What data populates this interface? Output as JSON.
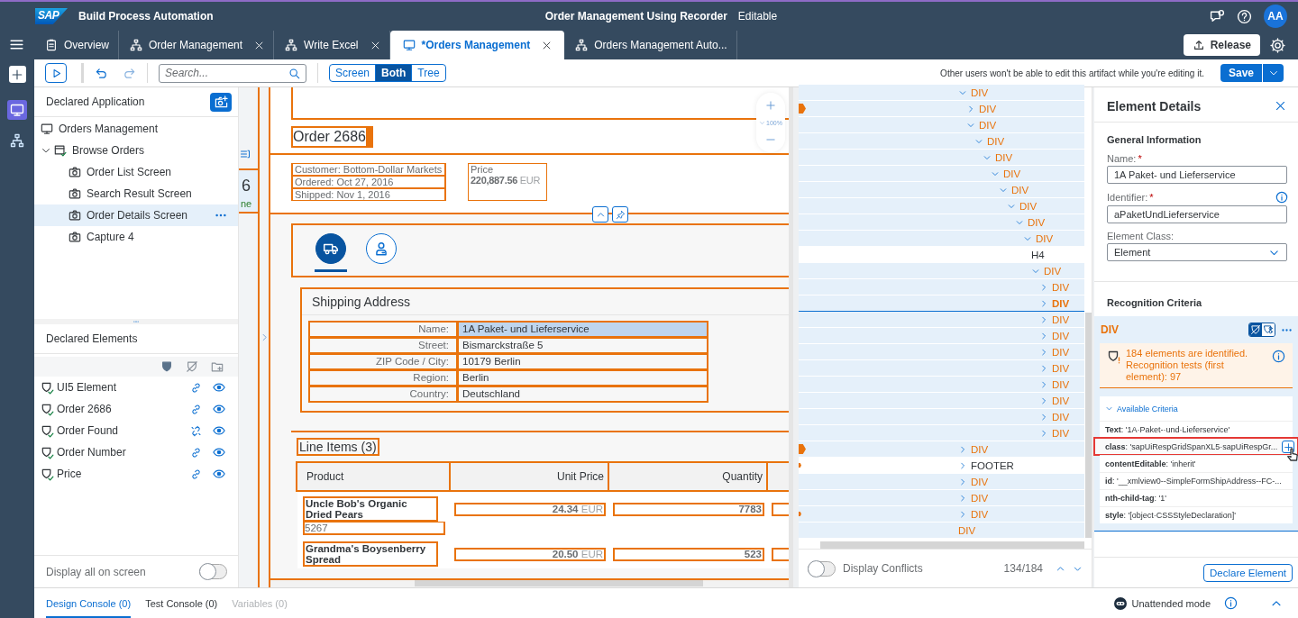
{
  "shell": {
    "logo": "SAP",
    "product": "Build Process Automation",
    "title": "Order Management Using Recorder",
    "status": "Editable",
    "avatar": "AA"
  },
  "tabs": [
    {
      "kind": "overview",
      "label": "Overview",
      "selected": false,
      "closable": false
    },
    {
      "kind": "process",
      "label": "Order Management",
      "selected": false,
      "closable": true
    },
    {
      "kind": "process",
      "label": "Write Excel",
      "selected": false,
      "closable": true
    },
    {
      "kind": "application",
      "label": "*Orders Management",
      "selected": true,
      "closable": true
    },
    {
      "kind": "process",
      "label": "Orders Management Auto...",
      "selected": false,
      "closable": false
    }
  ],
  "release_button": "Release",
  "rail": [
    {
      "kind": "screen",
      "selected": true
    },
    {
      "kind": "tree",
      "selected": false
    }
  ],
  "toolbar": {
    "search": {
      "placeholder": "Search..."
    },
    "view_modes": [
      {
        "label": "Screen",
        "selected": false
      },
      {
        "label": "Both",
        "selected": true
      },
      {
        "label": "Tree",
        "selected": false
      }
    ],
    "message": "Other users won't be able to edit this artifact while you're editing it.",
    "save_button": "Save"
  },
  "declared_application": {
    "title": "Declared Application",
    "tree": [
      {
        "kind": "application",
        "label": "Orders Management",
        "selected": false
      },
      {
        "kind": "page",
        "label": "Browse Orders",
        "selected": false,
        "expanded": true,
        "children": [
          {
            "kind": "screen",
            "label": "Order List Screen",
            "selected": false
          },
          {
            "kind": "screen",
            "label": "Search Result Screen",
            "selected": false
          },
          {
            "kind": "screen",
            "label": "Order Details Screen",
            "selected": true
          },
          {
            "kind": "screen",
            "label": "Capture 4",
            "selected": false
          }
        ]
      }
    ]
  },
  "declared_elements": {
    "title": "Declared Elements",
    "items": [
      {
        "label": "UI5 Element",
        "linked": true
      },
      {
        "label": "Order 2686",
        "linked": true
      },
      {
        "label": "Order Found",
        "linked": false
      },
      {
        "label": "Order Number",
        "linked": true
      },
      {
        "label": "Price",
        "linked": true
      }
    ]
  },
  "display_all": {
    "label": "Display all on screen",
    "on": false
  },
  "canvas": {
    "left_edge": {
      "count": "6",
      "status": "ne"
    },
    "zoom": "100%",
    "order": {
      "title": "Order 2686",
      "customer": "Customer: Bottom-Dollar Markets",
      "ordered": "Ordered: Oct 27, 2016",
      "shipped": "Shipped: Nov 1, 2016",
      "price_label": "Price",
      "price_value": "220,887.56",
      "price_currency": "EUR"
    },
    "icon_tabs": [
      {
        "kind": "truck",
        "selected": true
      },
      {
        "kind": "person",
        "selected": false
      }
    ],
    "shipping": {
      "title": "Shipping Address",
      "fields": [
        {
          "label": "Name:",
          "value": "1A Paket- und Lieferservice",
          "highlighted": true
        },
        {
          "label": "Street:",
          "value": "Bismarckstraße 5",
          "highlighted": false
        },
        {
          "label": "ZIP Code / City:",
          "value": "10179 Berlin",
          "highlighted": false
        },
        {
          "label": "Region:",
          "value": "Berlin",
          "highlighted": false
        },
        {
          "label": "Country:",
          "value": "Deutschland",
          "highlighted": false
        }
      ]
    },
    "line_items": {
      "title": "Line Items (3)",
      "columns": [
        "Product",
        "Unit Price",
        "Quantity"
      ],
      "rows": [
        {
          "product": "Uncle Bob's Organic Dried Pears",
          "product_number": "5267",
          "price": "24.34",
          "currency": "EUR",
          "quantity": "7783"
        },
        {
          "product": "Grandma's Boysenberry Spread",
          "price": "20.50",
          "currency": "EUR",
          "quantity": "523"
        }
      ]
    }
  },
  "dom_tree": {
    "rows": [
      {
        "tag": "DIV",
        "kind": "node",
        "expanded": true,
        "highlighted": true,
        "selected": false,
        "children": [
          {
            "tag": "DIV",
            "kind": "node",
            "expanded": false,
            "highlighted": true,
            "selected": false,
            "flagged": true
          },
          {
            "tag": "DIV",
            "kind": "node",
            "expanded": true,
            "highlighted": true,
            "selected": false,
            "children": [
              {
                "tag": "DIV",
                "kind": "node",
                "expanded": true,
                "highlighted": true,
                "selected": false,
                "children": [
                  {
                    "tag": "DIV",
                    "kind": "node",
                    "expanded": true,
                    "highlighted": true,
                    "selected": false,
                    "children": [
                      {
                        "tag": "DIV",
                        "kind": "node",
                        "expanded": true,
                        "highlighted": true,
                        "selected": false,
                        "children": [
                          {
                            "tag": "DIV",
                            "kind": "node",
                            "expanded": true,
                            "highlighted": true,
                            "selected": false,
                            "children": [
                              {
                                "tag": "DIV",
                                "kind": "node",
                                "expanded": true,
                                "highlighted": true,
                                "selected": false,
                                "children": [
                                  {
                                    "tag": "DIV",
                                    "kind": "node",
                                    "expanded": true,
                                    "highlighted": true,
                                    "selected": false,
                                    "children": [
                                      {
                                        "tag": "DIV",
                                        "kind": "node",
                                        "expanded": true,
                                        "highlighted": true,
                                        "selected": false,
                                        "children": [
                                          {
                                            "tag": "H4",
                                            "kind": "leaf",
                                            "highlighted": false,
                                            "selected": false
                                          },
                                          {
                                            "tag": "DIV",
                                            "kind": "node",
                                            "expanded": true,
                                            "highlighted": true,
                                            "selected": false,
                                            "children": [
                                              {
                                                "tag": "DIV",
                                                "kind": "node",
                                                "expanded": false,
                                                "highlighted": true,
                                                "selected": false
                                              },
                                              {
                                                "tag": "DIV",
                                                "kind": "node",
                                                "expanded": false,
                                                "highlighted": true,
                                                "selected": true
                                              },
                                              {
                                                "tag": "DIV",
                                                "kind": "node",
                                                "expanded": false,
                                                "highlighted": true,
                                                "selected": false
                                              },
                                              {
                                                "tag": "DIV",
                                                "kind": "node",
                                                "expanded": false,
                                                "highlighted": true,
                                                "selected": false
                                              },
                                              {
                                                "tag": "DIV",
                                                "kind": "node",
                                                "expanded": false,
                                                "highlighted": true,
                                                "selected": false
                                              },
                                              {
                                                "tag": "DIV",
                                                "kind": "node",
                                                "expanded": false,
                                                "highlighted": true,
                                                "selected": false
                                              },
                                              {
                                                "tag": "DIV",
                                                "kind": "node",
                                                "expanded": false,
                                                "highlighted": true,
                                                "selected": false
                                              },
                                              {
                                                "tag": "DIV",
                                                "kind": "node",
                                                "expanded": false,
                                                "highlighted": true,
                                                "selected": false
                                              },
                                              {
                                                "tag": "DIV",
                                                "kind": "node",
                                                "expanded": false,
                                                "highlighted": true,
                                                "selected": false
                                              },
                                              {
                                                "tag": "DIV",
                                                "kind": "node",
                                                "expanded": false,
                                                "highlighted": true,
                                                "selected": false
                                              }
                                            ]
                                          }
                                        ]
                                      }
                                    ]
                                  }
                                ]
                              }
                            ]
                          }
                        ]
                      }
                    ]
                  }
                ]
              }
            ]
          }
        ]
      },
      {
        "tag": "DIV",
        "kind": "node",
        "expanded": false,
        "highlighted": true,
        "selected": false,
        "flagged": true
      },
      {
        "tag": "FOOTER",
        "kind": "node",
        "expanded": false,
        "highlighted": false,
        "selected": false,
        "flagged": true,
        "flag_clipped": true
      },
      {
        "tag": "DIV",
        "kind": "node",
        "expanded": false,
        "highlighted": true,
        "selected": false
      },
      {
        "tag": "DIV",
        "kind": "node",
        "expanded": false,
        "highlighted": true,
        "selected": false
      },
      {
        "tag": "DIV",
        "kind": "node",
        "expanded": false,
        "highlighted": true,
        "selected": false,
        "flagged": true,
        "flag_clipped": true
      },
      {
        "tag": "DIV",
        "kind": "leaf",
        "highlighted": true,
        "selected": false
      }
    ],
    "conflicts_toggle": {
      "label": "Display Conflicts",
      "on": false
    },
    "counter": "134/184"
  },
  "details": {
    "title": "Element Details",
    "section": "General Information",
    "fields": [
      {
        "kind": "input",
        "label": "Name:",
        "required_mark": "*",
        "value": "1A Paket- und Lieferservice"
      },
      {
        "kind": "input",
        "label": "Identifier:",
        "required_mark": "*",
        "value": "aPaketUndLieferservice",
        "info": true
      },
      {
        "kind": "select",
        "label": "Element Class:",
        "value": "Element"
      }
    ],
    "recognition_title": "Recognition Criteria",
    "criteria_tag": "DIV",
    "criteria_modes": [
      {
        "selected": true
      },
      {
        "selected": false
      }
    ],
    "warning": "184 elements are identified. Recognition tests (first element): 97",
    "available": {
      "label": "Available Criteria",
      "expanded": true,
      "items": [
        {
          "text": "**Text**: '1A·Paket-·und·Lieferservice'",
          "highlighted": false
        },
        {
          "text": "**class**: 'sapUiRespGridSpanXL5·sapUiRespGr...",
          "highlighted": true
        },
        {
          "text": "**contentEditable**: 'inherit'",
          "highlighted": false
        },
        {
          "text": "**id**: '__xmlview0--SimpleFormShipAddress--FC-...",
          "highlighted": false
        },
        {
          "text": "**nth-child-tag**: '1'",
          "highlighted": false
        },
        {
          "text": "**style**: '[object·CSSStyleDeclaration]'",
          "highlighted": false
        }
      ]
    },
    "declare_button": "Declare Element"
  },
  "console_tabs": [
    {
      "label": "Design Console (0)",
      "selected": true,
      "disabled": false
    },
    {
      "label": "Test Console (0)",
      "selected": false,
      "disabled": false
    },
    {
      "label": "Variables (0)",
      "selected": false,
      "disabled": true
    }
  ],
  "unattended": "Unattended mode"
}
